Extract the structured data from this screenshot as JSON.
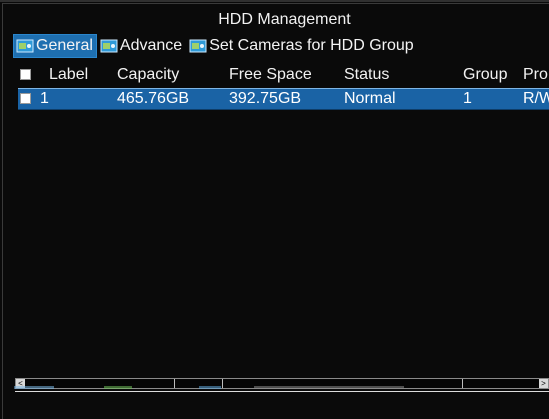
{
  "window": {
    "title": "HDD Management"
  },
  "tabs": [
    {
      "label": "General",
      "active": true,
      "icon": "hdd-icon"
    },
    {
      "label": "Advance",
      "active": false,
      "icon": "hdd-icon"
    },
    {
      "label": "Set Cameras for HDD Group",
      "active": false,
      "icon": "hdd-icon"
    }
  ],
  "table": {
    "columns": [
      "Label",
      "Capacity",
      "Free Space",
      "Status",
      "Group",
      "Pro"
    ],
    "rows": [
      {
        "label": "1",
        "capacity": "465.76GB",
        "free_space": "392.75GB",
        "status": "Normal",
        "group": "1",
        "property": "R/W",
        "selected": true
      }
    ]
  },
  "scrollbar": {
    "left_arrow": "<",
    "right_arrow": ">"
  },
  "colors": {
    "background": "#0a0a0a",
    "selection": "#1a63a5",
    "active_tab": "#1e6fb0",
    "text": "#ffffff"
  }
}
